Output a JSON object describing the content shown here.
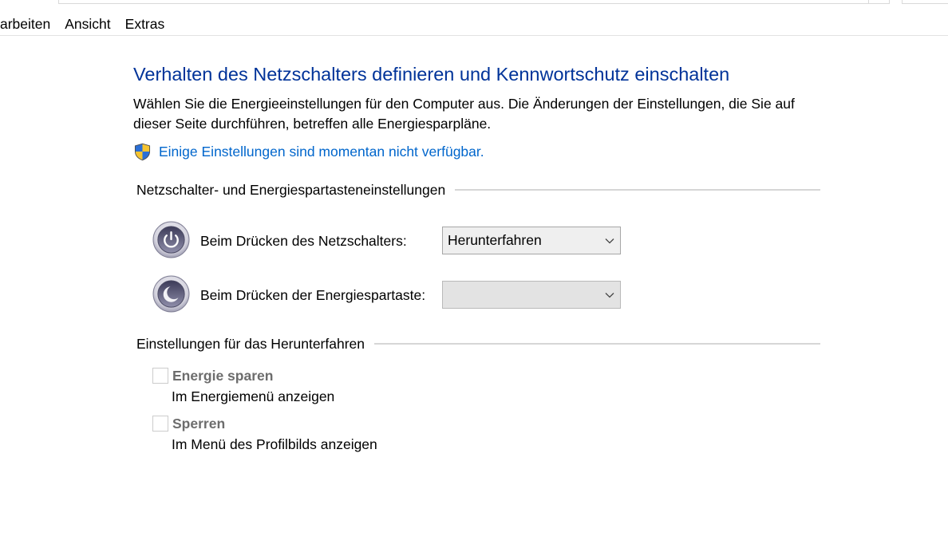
{
  "menu_bar": {
    "items": [
      {
        "label": "arbeiten"
      },
      {
        "label": "Ansicht"
      },
      {
        "label": "Extras"
      }
    ]
  },
  "page": {
    "title": "Verhalten des Netzschalters definieren und Kennwortschutz einschalten",
    "description": "Wählen Sie die Energieeinstellungen für den Computer aus. Die Änderungen der Einstellungen, die Sie auf dieser Seite durchführen, betreffen alle Energiesparpläne.",
    "admin_link": {
      "icon": "uac-shield-icon",
      "label": "Einige Einstellungen sind momentan nicht verfügbar."
    }
  },
  "button_settings": {
    "heading": "Netzschalter- und Energiespartasteneinstellungen",
    "rows": [
      {
        "icon": "power-button-icon",
        "label": "Beim Drücken des Netzschalters:",
        "selected": "Herunterfahren",
        "select_icon": "chevron-down-icon",
        "disabled": false
      },
      {
        "icon": "sleep-button-icon",
        "label": "Beim Drücken der Energiespartaste:",
        "selected": "",
        "select_icon": "chevron-down-icon",
        "disabled": true
      }
    ]
  },
  "shutdown_settings": {
    "heading": "Einstellungen für das Herunterfahren",
    "options": [
      {
        "label": "Energie sparen",
        "description": "Im Energiemenü anzeigen",
        "checked": false,
        "disabled": true
      },
      {
        "label": "Sperren",
        "description": "Im Menü des Profilbilds anzeigen",
        "checked": false,
        "disabled": true
      }
    ]
  },
  "colors": {
    "title": "#003399",
    "link": "#0066cc",
    "disabled_text": "#6d6d6d",
    "shield_blue": "#2a6fd6",
    "shield_yellow": "#f6c430"
  }
}
